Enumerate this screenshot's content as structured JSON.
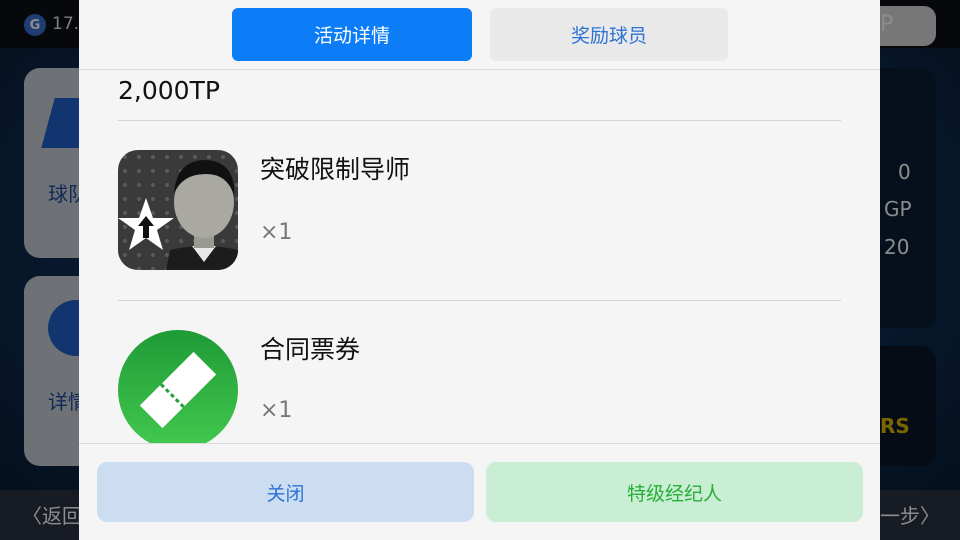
{
  "background": {
    "top_number": "17.",
    "tp_badge": "P",
    "card_a_text": "球队",
    "card_b_text": "详情",
    "right_values": [
      "0",
      "GP",
      "20"
    ],
    "right_banner": "RS",
    "back_label": "返回",
    "next_label": "一步"
  },
  "modal": {
    "tabs": [
      {
        "label": "活动详情",
        "active": true
      },
      {
        "label": "奖励球员",
        "active": false
      }
    ],
    "amount": "2,000TP",
    "items": [
      {
        "name": "突破限制导师",
        "qty": "×1",
        "icon": "coach-avatar-icon"
      },
      {
        "name": "合同票券",
        "qty": "×1",
        "icon": "contract-ticket-icon"
      }
    ],
    "buttons": {
      "close": "关闭",
      "agent": "特级经纪人"
    }
  },
  "colors": {
    "tab_active": "#0c7cf7",
    "close_button_bg": "#ccdcf1",
    "agent_button_bg": "#c9eed3",
    "agent_button_text": "#27b038",
    "ticket_green": "#23a03a"
  }
}
